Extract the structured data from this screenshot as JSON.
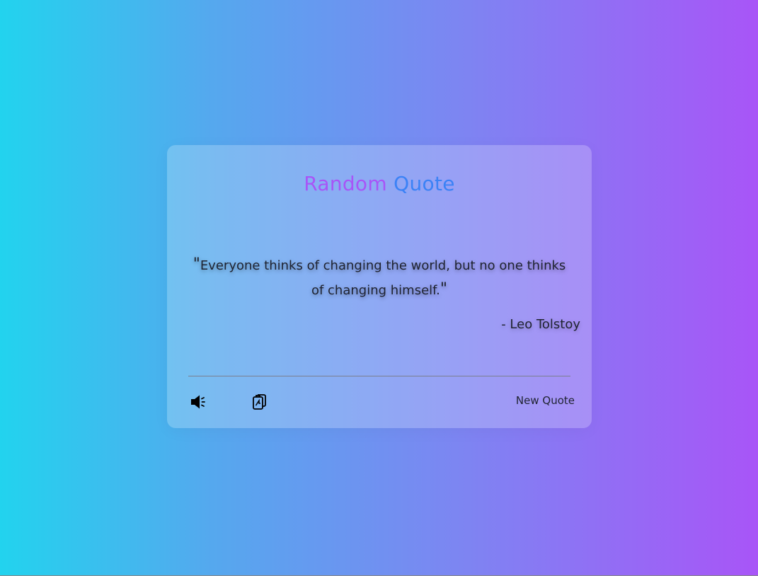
{
  "title": {
    "word1": "Random",
    "word2": "Quote"
  },
  "quote": {
    "open_mark": "\"",
    "text": "Everyone thinks of changing the world, but no one thinks of changing himself.",
    "close_mark": "\"",
    "author": "- Leo Tolstoy"
  },
  "actions": {
    "speak_icon": "speaker-icon",
    "copy_icon": "clipboard-icon",
    "new_quote_label": "New Quote"
  },
  "colors": {
    "background_start": "#22d3ee",
    "background_end": "#a855f7",
    "title_word1": "#a855f7",
    "title_word2": "#3b82f6"
  }
}
